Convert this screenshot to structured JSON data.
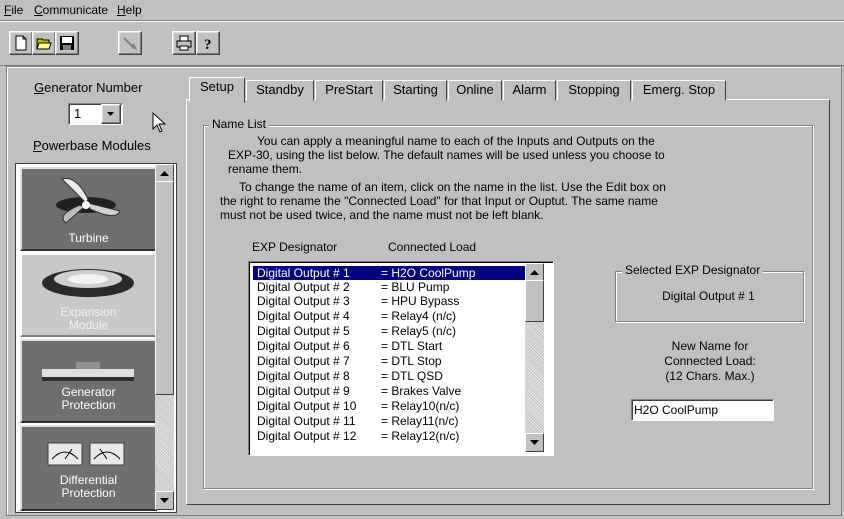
{
  "menu": [
    {
      "label": "File",
      "accel": "F",
      "rest": "ile"
    },
    {
      "label": "Communicate",
      "accel": "C",
      "rest": "ommunicate"
    },
    {
      "label": "Help",
      "accel": "H",
      "rest": "elp"
    }
  ],
  "toolbar_icons": [
    "new-document-icon",
    "open-folder-icon",
    "save-disk-icon",
    "connect-icon",
    "print-icon",
    "help-icon"
  ],
  "left_panel": {
    "generator_label_accel": "G",
    "generator_label_rest": "enerator Number",
    "generator_value": "1",
    "powerbase_label_accel": "P",
    "powerbase_label_rest": "owerbase Modules",
    "modules": [
      {
        "name": "Turbine",
        "icon": "turbine-icon"
      },
      {
        "name_line1": "Expansion",
        "name_line2": "Module",
        "icon": "expansion-module-icon"
      },
      {
        "name_line1": "Generator",
        "name_line2": "Protection",
        "icon": "generator-protection-icon"
      },
      {
        "name_line1": "Differential",
        "name_line2": "Protection",
        "icon": "differential-protection-icon"
      }
    ]
  },
  "tabs": [
    "Setup",
    "Standby",
    "PreStart",
    "Starting",
    "Online",
    "Alarm",
    "Stopping",
    "Emerg. Stop"
  ],
  "name_list": {
    "title": "Name List",
    "para1_line1": "You can apply a meaningful name to each of the Inputs and Outputs on the",
    "para1_line2": "EXP-30, using the list below.  The default names will be used unless you choose to",
    "para1_line3": "rename them.",
    "para2_line1": "To change the name of an item, click on the name in the list.  Use the Edit box on",
    "para2_line2": "the right to rename the \"Connected Load\" for that Input or Ouptut.  The same name",
    "para2_line3": "must not be used twice, and the name must not be left blank.",
    "col_designator": "EXP Designator",
    "col_load": "Connected Load",
    "items": [
      {
        "designator": "Digital Output # 1",
        "load": "= H2O CoolPump"
      },
      {
        "designator": "Digital Output # 2",
        "load": "= BLU Pump"
      },
      {
        "designator": "Digital Output # 3",
        "load": "= HPU Bypass"
      },
      {
        "designator": "Digital Output # 4",
        "load": "= Relay4 (n/c)"
      },
      {
        "designator": "Digital Output # 5",
        "load": "= Relay5 (n/c)"
      },
      {
        "designator": "Digital Output # 6",
        "load": "= DTL Start"
      },
      {
        "designator": "Digital Output # 7",
        "load": "= DTL Stop"
      },
      {
        "designator": "Digital Output # 8",
        "load": "= DTL QSD"
      },
      {
        "designator": "Digital Output # 9",
        "load": "= Brakes Valve"
      },
      {
        "designator": "Digital Output # 10",
        "load": "= Relay10(n/c)"
      },
      {
        "designator": "Digital Output # 11",
        "load": "= Relay11(n/c)"
      },
      {
        "designator": "Digital Output # 12",
        "load": "= Relay12(n/c)"
      }
    ],
    "selected_title": "Selected EXP Designator",
    "selected_value": "Digital Output # 1",
    "new_name_line1": "New Name for",
    "new_name_line2": "Connected Load:",
    "new_name_line3": "(12 Chars. Max.)",
    "new_name_value": "H2O CoolPump"
  }
}
